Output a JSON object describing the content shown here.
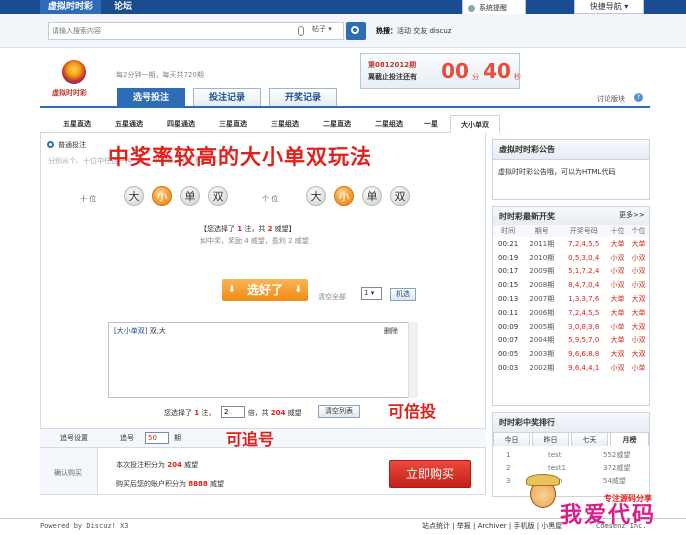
{
  "topbar": {
    "nav": [
      "虚拟时时彩",
      "论坛"
    ],
    "remind": "系统提醒",
    "quicknav": "快捷导航 ▾"
  },
  "search": {
    "placeholder": "请输入搜索内容",
    "scope": "帖子 ▾",
    "hot_label": "热搜：",
    "hot_items": "活动  交友  discuz"
  },
  "header": {
    "logo_text": "虚拟时时彩",
    "tagline": "每2分钟一期，每天共720期",
    "issue": "第0812012期",
    "deadline_label": "离截止投注还有",
    "minutes": "00",
    "min_unit": "分",
    "seconds": "40",
    "sec_unit": "秒",
    "discussion": "讨论版块",
    "help": "?",
    "tabs": [
      "选号投注",
      "投注记录",
      "开奖记录"
    ]
  },
  "subtabs": [
    "五星直选",
    "五星通选",
    "四星通选",
    "三星直选",
    "三星组选",
    "二星直选",
    "二星组选",
    "一星",
    "大小单双"
  ],
  "betting": {
    "mode": "普通投注",
    "desc": "分别从个、十位中任选一种（大、小、单、双）性质…",
    "banner": "中奖率较高的大小单双玩法",
    "positions": [
      {
        "label": "十  位",
        "balls": [
          "大",
          "小",
          "单",
          "双"
        ],
        "selected": 1
      },
      {
        "label": "个  位",
        "balls": [
          "大",
          "小",
          "单",
          "双"
        ],
        "selected": 1
      }
    ],
    "sel_pre": "【您选择了 ",
    "sel_count": "1",
    "sel_mid": " 注，共 ",
    "sel_amount": "2",
    "sel_unit": " 威望】",
    "prize_info": "如中奖，奖励 4 威望，盈利 2 威望",
    "choose_btn": "选好了",
    "clear_all": "清空全部",
    "multiple": "1",
    "confirm": "机选",
    "list_type": "[大小单双]",
    "list_value": " 双,大",
    "list_delete": "删除",
    "sum_pre": "您选择了 ",
    "sum_count": "1",
    "sum_mid": " 注，",
    "sum_times_value": "2",
    "sum_after": " 倍，共 ",
    "sum_total": "204",
    "sum_unit": " 威望",
    "clear_list": "清空列表",
    "note_multiple": "可倍投",
    "chase_setting": "追号设置",
    "chase_label": "追号",
    "chase_value": "50",
    "chase_unit": "期",
    "note_chase": "可追号",
    "confirm_buy": "确认购买",
    "cost_pre": "本次投注积分为 ",
    "cost_value": "204",
    "cost_unit": " 威望",
    "remain_pre": "购买后您的账户积分为 ",
    "remain_value": "8888",
    "remain_unit": " 威望",
    "buy_now": "立即购买"
  },
  "notice": {
    "title": "虚拟时时彩公告",
    "text": "虚拟时时彩公告哦，可以为HTML代码"
  },
  "latest": {
    "title": "时时彩最新开奖",
    "more": "更多>>",
    "columns": [
      "时间",
      "期号",
      "开奖号码",
      "十位",
      "个位"
    ],
    "rows": [
      [
        "00:21",
        "2011期",
        "7,2,4,5,5",
        "大单",
        "大单"
      ],
      [
        "00:19",
        "2010期",
        "0,5,3,0,4",
        "小双",
        "小双"
      ],
      [
        "00:17",
        "2009期",
        "5,1,7,2,4",
        "小双",
        "小双"
      ],
      [
        "00:15",
        "2008期",
        "8,4,7,0,4",
        "小双",
        "小双"
      ],
      [
        "00:13",
        "2007期",
        "1,3,3,7,6",
        "大单",
        "大双"
      ],
      [
        "00:11",
        "2006期",
        "7,2,4,5,5",
        "大单",
        "大单"
      ],
      [
        "00:09",
        "2005期",
        "3,0,8,3,8",
        "小单",
        "大双"
      ],
      [
        "00:07",
        "2004期",
        "5,9,5,7,0",
        "大单",
        "小双"
      ],
      [
        "00:05",
        "2003期",
        "9,6,6,8,8",
        "大双",
        "大双"
      ],
      [
        "00:03",
        "2002期",
        "9,6,4,4,1",
        "小双",
        "小单"
      ]
    ]
  },
  "ranking": {
    "title": "时时彩中奖排行",
    "tabs": [
      "今日",
      "昨日",
      "七天",
      "月榜"
    ],
    "rows": [
      [
        "1",
        "test",
        "552威望"
      ],
      [
        "2",
        "test1",
        "372威望"
      ],
      [
        "3",
        "zhin",
        "54威望"
      ]
    ]
  },
  "footer": {
    "powered": "Powered by Discuz! X3",
    "links": "站点统计 | 举报 | Archiver | 手机版 | 小黑屋",
    "company": "Comsenz Inc."
  },
  "watermark": {
    "main": "我爱代码",
    "sub": "专注源码分享"
  },
  "colors": {
    "primary": "#2e6cb5",
    "accent_red": "#e0201b",
    "orange": "#f08a12"
  }
}
